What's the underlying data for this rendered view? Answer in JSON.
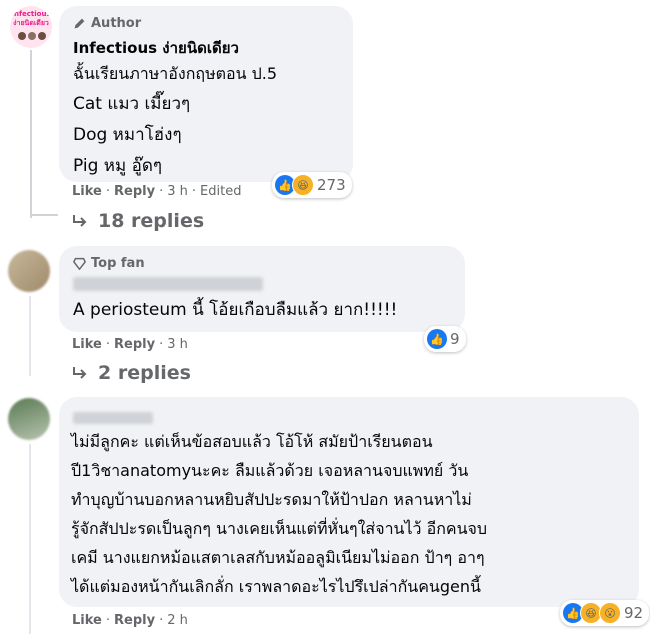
{
  "comments": [
    {
      "badge": "Author",
      "name": "Infectious ง่ายนิดเดียว",
      "lines": [
        "ฉั้นเรียนภาษาอังกฤษตอน ป.5",
        "Cat แมว เมี๊ยวๆ",
        "Dog หมาโฮ่งๆ",
        "Pig หมู อู๊ดๆ"
      ],
      "like": "Like",
      "reply": "Reply",
      "time": "3 h",
      "edited": "Edited",
      "reaction_count": "273",
      "replies": "18 replies"
    },
    {
      "badge": "Top fan",
      "lines": [
        "A periosteum นี้ โอ้ยเกือบลืมแล้ว ยาก!!!!!"
      ],
      "like": "Like",
      "reply": "Reply",
      "time": "3 h",
      "reaction_count": "9",
      "replies": "2 replies"
    },
    {
      "lines": [
        "ไม่มีลูกคะ แต่เห็นข้อสอบแล้ว โอ้โห้ สมัยป้าเรียนตอน",
        "ปี1วิชาanatomyนะคะ ลืมแล้วด้วย เจอหลานจบแพทย์ วัน",
        "ทำบุญบ้านบอกหลานหยิบสัปปะรดมาให้ป้าปอก หลานหาไม่",
        "รู้จักสัปปะรดเป็นลูกๆ นางเคยเห็นแต่ที่หั่นๆใส่จานไว้ อีกคนจบ",
        "เคมี นางแยกหม้อแสตาเลสกับหม้ออลูมิเนียมไม่ออก ป้าๆ อาๆ",
        "ได้แต่มองหน้ากันเลิกลั่ก เราพลาดอะไรไปรึเปล่ากันคนgenนี้"
      ],
      "like": "Like",
      "reply": "Reply",
      "time": "2 h",
      "reaction_count": "92"
    }
  ],
  "avatar_text": [
    "Infectious",
    "ง่ายนิดเดียว"
  ],
  "colors": {
    "like_blue": "#1877f2",
    "haha_yellow": "#f7b125",
    "bubble": "#f0f2f5",
    "meta_gray": "#65676b",
    "avatar_pink": "#e91e8c"
  }
}
